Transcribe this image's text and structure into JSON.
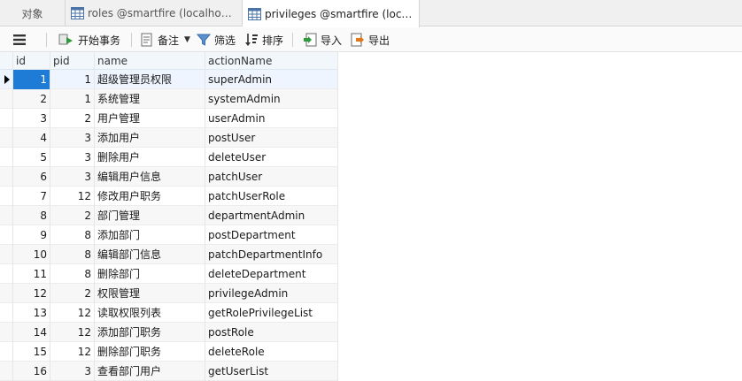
{
  "tabs": [
    {
      "label": "对象"
    },
    {
      "label": "roles @smartfire (localhost_..."
    },
    {
      "label": "privileges @smartfire (local..."
    }
  ],
  "toolbar": {
    "begin_txn": "开始事务",
    "memo": "备注",
    "filter": "筛选",
    "sort": "排序",
    "import": "导入",
    "export": "导出"
  },
  "grid": {
    "columns": [
      "id",
      "pid",
      "name",
      "actionName"
    ],
    "rows": [
      {
        "id": "1",
        "pid": "1",
        "name": "超级管理员权限",
        "action": "superAdmin"
      },
      {
        "id": "2",
        "pid": "1",
        "name": "系统管理",
        "action": "systemAdmin"
      },
      {
        "id": "3",
        "pid": "2",
        "name": "用户管理",
        "action": "userAdmin"
      },
      {
        "id": "4",
        "pid": "3",
        "name": "添加用户",
        "action": "postUser"
      },
      {
        "id": "5",
        "pid": "3",
        "name": "删除用户",
        "action": "deleteUser"
      },
      {
        "id": "6",
        "pid": "3",
        "name": "编辑用户信息",
        "action": "patchUser"
      },
      {
        "id": "7",
        "pid": "12",
        "name": "修改用户职务",
        "action": "patchUserRole"
      },
      {
        "id": "8",
        "pid": "2",
        "name": "部门管理",
        "action": "departmentAdmin"
      },
      {
        "id": "9",
        "pid": "8",
        "name": "添加部门",
        "action": "postDepartment"
      },
      {
        "id": "10",
        "pid": "8",
        "name": "编辑部门信息",
        "action": "patchDepartmentInfo"
      },
      {
        "id": "11",
        "pid": "8",
        "name": "删除部门",
        "action": "deleteDepartment"
      },
      {
        "id": "12",
        "pid": "2",
        "name": "权限管理",
        "action": "privilegeAdmin"
      },
      {
        "id": "13",
        "pid": "12",
        "name": "读取权限列表",
        "action": "getRolePrivilegeList"
      },
      {
        "id": "14",
        "pid": "12",
        "name": "添加部门职务",
        "action": "postRole"
      },
      {
        "id": "15",
        "pid": "12",
        "name": "删除部门职务",
        "action": "deleteRole"
      },
      {
        "id": "16",
        "pid": "3",
        "name": "查看部门用户",
        "action": "getUserList"
      }
    ]
  }
}
